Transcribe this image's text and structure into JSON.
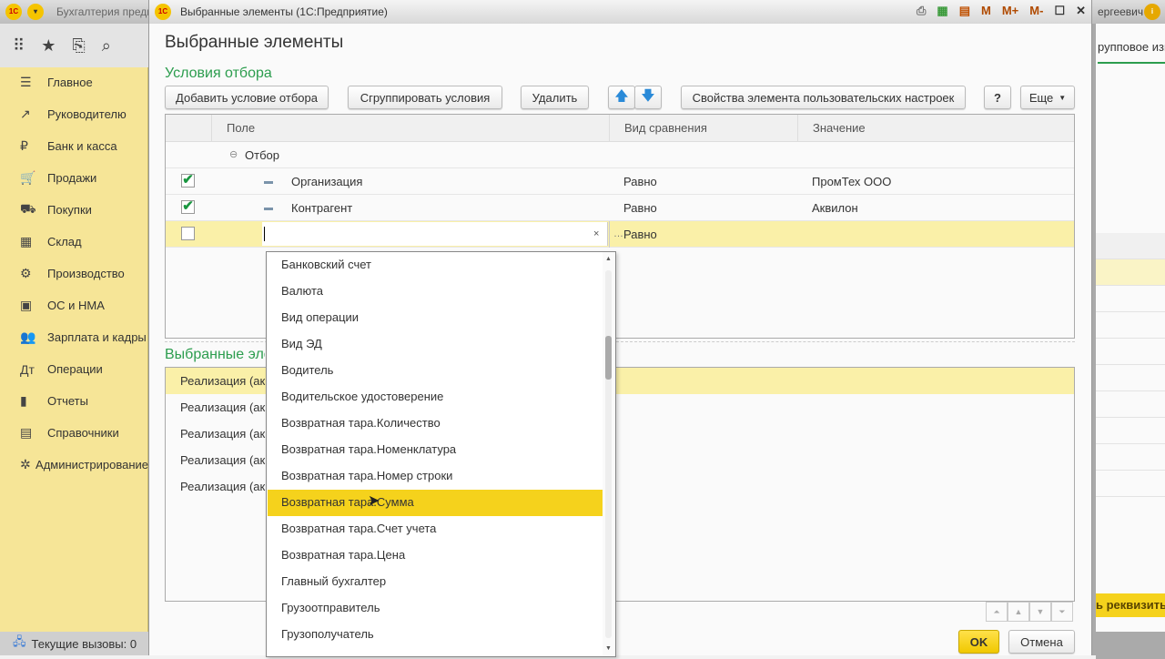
{
  "background_app": {
    "title": "Бухгалтерия предпр",
    "user": "ергеевич",
    "tab": "рупповое изм",
    "action_button": "ь реквизиты"
  },
  "sidebar": {
    "items": [
      {
        "label": "Главное",
        "icon": "menu-icon",
        "glyph": "☰"
      },
      {
        "label": "Руководителю",
        "icon": "trend-icon",
        "glyph": "↗"
      },
      {
        "label": "Банк и касса",
        "icon": "coin-icon",
        "glyph": "₽"
      },
      {
        "label": "Продажи",
        "icon": "cart-icon",
        "glyph": "🛒"
      },
      {
        "label": "Покупки",
        "icon": "truck-icon",
        "glyph": "⛟"
      },
      {
        "label": "Склад",
        "icon": "warehouse-icon",
        "glyph": "▦"
      },
      {
        "label": "Производство",
        "icon": "factory-icon",
        "glyph": "⚙"
      },
      {
        "label": "ОС и НМА",
        "icon": "assets-icon",
        "glyph": "▣"
      },
      {
        "label": "Зарплата и кадры",
        "icon": "people-icon",
        "glyph": "👥"
      },
      {
        "label": "Операции",
        "icon": "debit-credit-icon",
        "glyph": "Дт"
      },
      {
        "label": "Отчеты",
        "icon": "bar-chart-icon",
        "glyph": "▮"
      },
      {
        "label": "Справочники",
        "icon": "books-icon",
        "glyph": "▤"
      },
      {
        "label": "Администрирование",
        "icon": "gear-icon",
        "glyph": "✲"
      }
    ],
    "status": "Текущие вызовы: 0"
  },
  "window": {
    "caption": "Выбранные элементы  (1С:Предприятие)",
    "title": "Выбранные элементы",
    "toolbar_icons": [
      "M",
      "M+",
      "M-"
    ]
  },
  "filter": {
    "section_title": "Условия отбора",
    "buttons": {
      "add": "Добавить условие отбора",
      "group": "Сгруппировать условия",
      "delete": "Удалить",
      "properties": "Свойства элемента пользовательских настроек",
      "help": "?",
      "more": "Еще"
    },
    "columns": {
      "field": "Поле",
      "comparison": "Вид сравнения",
      "value": "Значение"
    },
    "group_label": "Отбор",
    "rows": [
      {
        "checked": true,
        "field": "Организация",
        "comparison": "Равно",
        "value": "ПромТех ООО"
      },
      {
        "checked": true,
        "field": "Контрагент",
        "comparison": "Равно",
        "value": "Аквилон"
      },
      {
        "checked": false,
        "field": "",
        "comparison": "Равно",
        "value": ""
      }
    ]
  },
  "selected": {
    "section_title": "Выбранные элементы",
    "rows": [
      "Реализация (ак",
      "Реализация (ак",
      "Реализация (ак",
      "Реализация (ак",
      "Реализация (ак"
    ]
  },
  "dropdown": {
    "items": [
      "Банковский счет",
      "Валюта",
      "Вид операции",
      "Вид ЭД",
      "Водитель",
      "Водительское удостоверение",
      "Возвратная тара.Количество",
      "Возвратная тара.Номенклатура",
      "Возвратная тара.Номер строки",
      "Возвратная тара.Сумма",
      "Возвратная тара.Счет учета",
      "Возвратная тара.Цена",
      "Главный бухгалтер",
      "Грузоотправитель",
      "Грузополучатель"
    ],
    "selected_index": 9
  },
  "footer": {
    "ok": "OK",
    "cancel": "Отмена"
  },
  "colors": {
    "accent_green": "#2c9d4e",
    "sidebar": "#f6e597",
    "highlight": "#f5d21c",
    "row_highlight": "#faf0a8"
  }
}
